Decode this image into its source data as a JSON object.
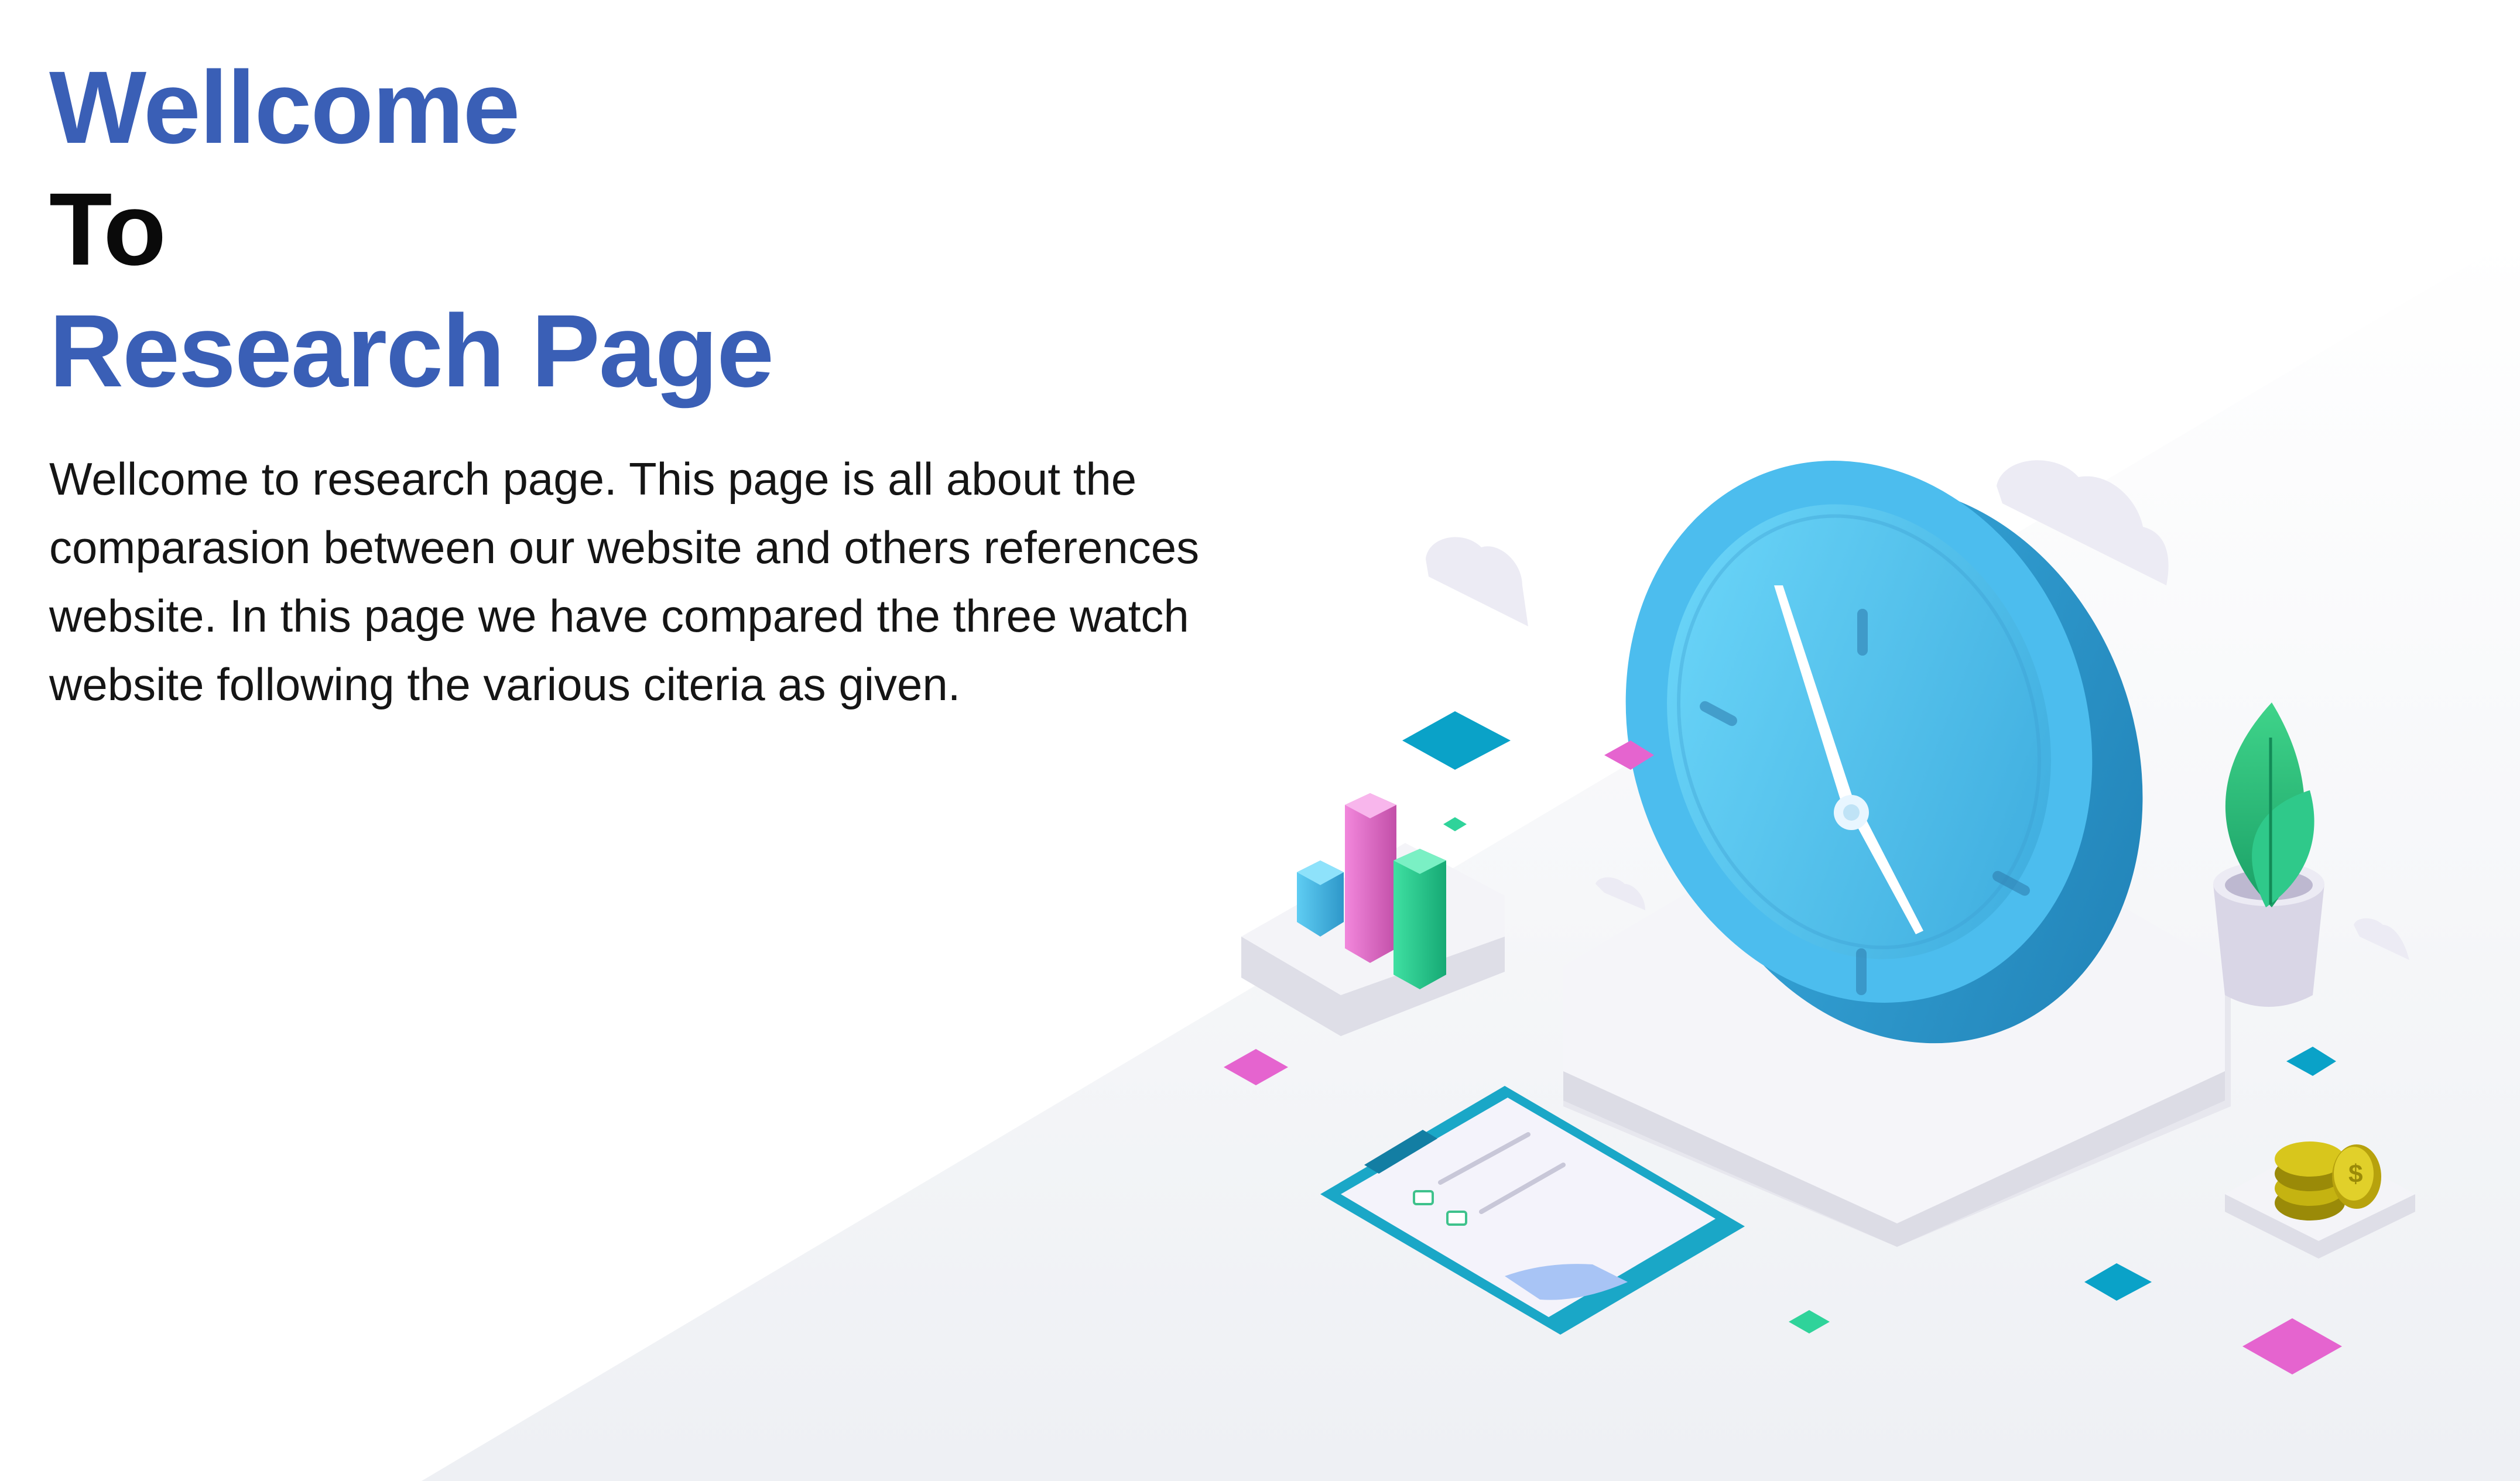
{
  "hero": {
    "line1": "Wellcome",
    "line2": "To",
    "line3": "Research Page",
    "paragraph": "Wellcome to research page. This page is all about the comparasion between our website and others references website. In this page we have compared the three watch website following the various citeria as given."
  },
  "colors": {
    "heading_blue": "#3a5fb6",
    "heading_black": "#0a0a0a",
    "clock_blue": "#4ec3ee",
    "bar_pink": "#e86bd0",
    "bar_green": "#26c98e",
    "bar_blue": "#46b6e6"
  },
  "illustration": {
    "icons": [
      "clock-icon",
      "bar-chart-icon",
      "plant-icon",
      "clipboard-icon",
      "coins-icon",
      "cloud-icon"
    ]
  }
}
